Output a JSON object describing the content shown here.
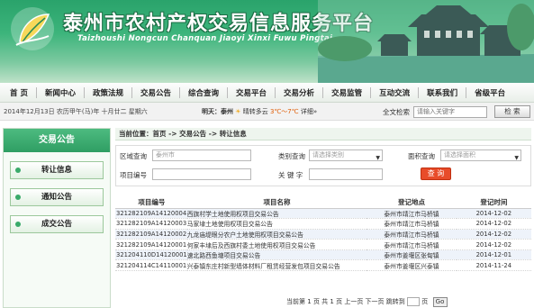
{
  "banner": {
    "title": "泰州市农村产权交易信息服务平台",
    "pinyin": "Taizhoushi Nongcun Chanquan Jiaoyi Xinxi Fuwu Pingtai"
  },
  "nav": [
    "首 页",
    "新闻中心",
    "政策法规",
    "交易公告",
    "综合查询",
    "交易平台",
    "交易分析",
    "交易监管",
    "互动交流",
    "联系我们",
    "省级平台"
  ],
  "infobar": {
    "date": "2014年12月13日 农历甲午(马)年 十月廿二 星期六",
    "weather_label": "明天：泰州",
    "weather_desc": "晴转多云",
    "weather_temp": "3℃～7℃",
    "weather_detail": "详细»",
    "search_label": "全文检索",
    "search_placeholder": "请输入关键字",
    "search_button": "检 索"
  },
  "sidebar": {
    "head": "交易公告",
    "items": [
      "转让信息",
      "通知公告",
      "成交公告"
    ]
  },
  "main": {
    "breadcrumb": "当前位置：首页 -> 交易公告 -> 转让信息",
    "filters": {
      "region_label": "区域查询",
      "region_value": "泰州市",
      "type_label": "类别查询",
      "type_value": "请选择类别",
      "area_label": "面积查询",
      "area_value": "请选择面积",
      "project_label": "项目编号",
      "project_value": "",
      "keyword_label": "关 键 字",
      "keyword_value": "",
      "query_button": "查 询"
    },
    "table": {
      "headers": [
        "项目编号",
        "项目名称",
        "登记地点",
        "登记时间"
      ],
      "rows": [
        [
          "321282109A14120004",
          "西旗村学土地使用权项目交易公告",
          "泰州市靖江市马桥镇",
          "2014-12-02"
        ],
        [
          "321282109A14120003",
          "马家埭土地使用权项目交易公告",
          "泰州市靖江市马桥镇",
          "2014-12-02"
        ],
        [
          "321282109A14120002",
          "九龙庙堤眼分农户土地使用权项目交易公告",
          "泰州市靖江市马桥镇",
          "2014-12-02"
        ],
        [
          "321282109A14120001",
          "何家丰埭后及西旗村委土地使用权项目交易公告",
          "泰州市靖江市马桥镇",
          "2014-12-02"
        ],
        [
          "321204110D14120001",
          "速北路西鱼塘项目交易公告",
          "泰州市姜堰区张甸镇",
          "2014-12-01"
        ],
        [
          "321204114C14110001",
          "兴泰镇东庄村新型墙体材料厂租赁经营发包项目交易公告",
          "泰州市姜堰区兴泰镇",
          "2014-11-24"
        ]
      ]
    },
    "pager": {
      "prefix": "当前第",
      "current": "1",
      "mid": "页 共",
      "total": "1",
      "suffix": "页 上一页 下一页 跳转到",
      "tail": "页",
      "go": "Go"
    }
  }
}
